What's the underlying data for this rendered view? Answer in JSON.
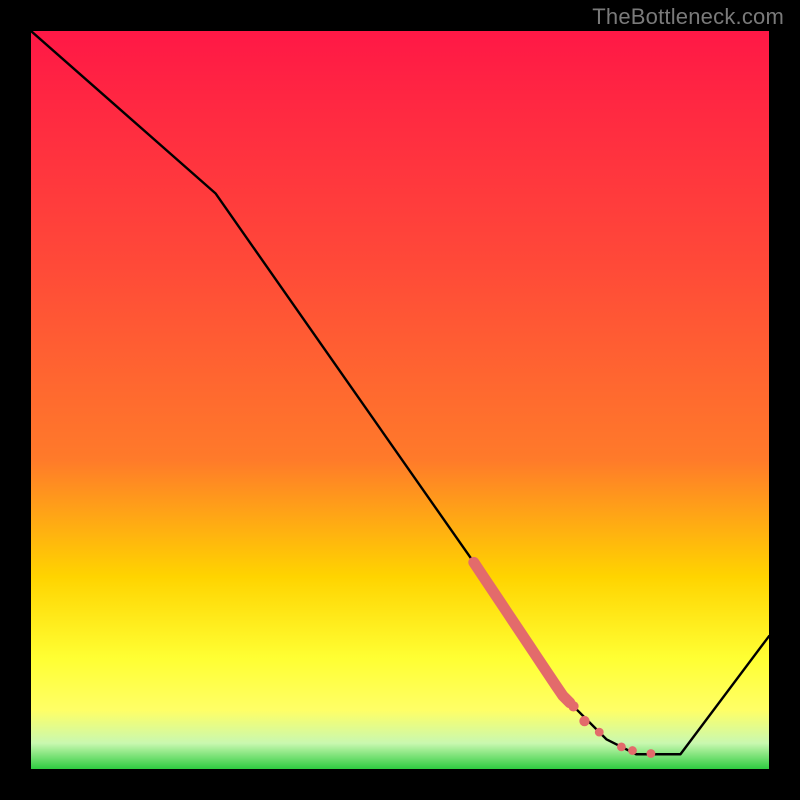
{
  "attribution": "TheBottleneck.com",
  "colors": {
    "top": "#ff1846",
    "mid1": "#ff7a2a",
    "mid2": "#ffd400",
    "lowYellow": "#ffff66",
    "paleGreen": "#c9f8b0",
    "green": "#2ecc40",
    "line": "#000000",
    "dot": "#e36b6b"
  },
  "chart_data": {
    "type": "line",
    "title": "",
    "xlabel": "",
    "ylabel": "",
    "xlim": [
      0,
      100
    ],
    "ylim": [
      0,
      100
    ],
    "curve": [
      {
        "x": 0,
        "y": 100
      },
      {
        "x": 25,
        "y": 78
      },
      {
        "x": 60,
        "y": 28
      },
      {
        "x": 72,
        "y": 10
      },
      {
        "x": 78,
        "y": 4
      },
      {
        "x": 82,
        "y": 2
      },
      {
        "x": 88,
        "y": 2
      },
      {
        "x": 100,
        "y": 18
      }
    ],
    "dot_segment": {
      "x_start": 60,
      "x_end": 73,
      "thickness": "thick"
    },
    "extra_dots": [
      {
        "x": 73.5,
        "y": 8.5
      },
      {
        "x": 75,
        "y": 6.5
      },
      {
        "x": 77,
        "y": 5.0
      },
      {
        "x": 80,
        "y": 3.0
      },
      {
        "x": 81.5,
        "y": 2.5
      },
      {
        "x": 84,
        "y": 2.1
      }
    ]
  }
}
